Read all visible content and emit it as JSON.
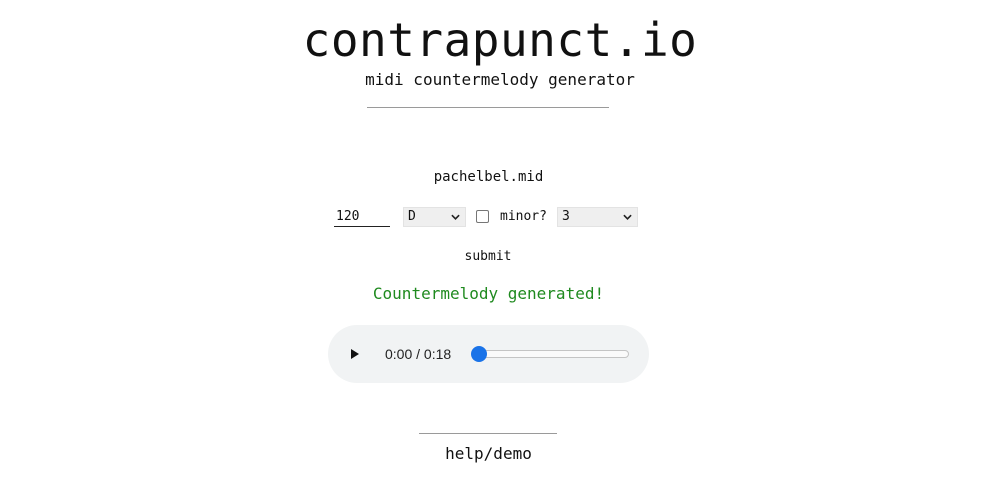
{
  "header": {
    "title": "contrapunct.io",
    "subtitle": "midi countermelody generator"
  },
  "form": {
    "file_name": "pachelbel.mid",
    "tempo_value": "120",
    "key_select": {
      "selected": "D"
    },
    "minor_checkbox": {
      "label": "minor?",
      "checked": false
    },
    "mode_select": {
      "selected": "3"
    },
    "submit_label": "submit"
  },
  "status": {
    "message": "Countermelody generated!",
    "color": "#1f8a1f"
  },
  "audio_player": {
    "time_display": "0:00 / 0:18",
    "progress": 0,
    "accent_color": "#1a73e8"
  },
  "footer": {
    "help_link": "help/demo"
  },
  "icons": {
    "play": "play-icon",
    "dropdown": "chevron-down-icon"
  }
}
